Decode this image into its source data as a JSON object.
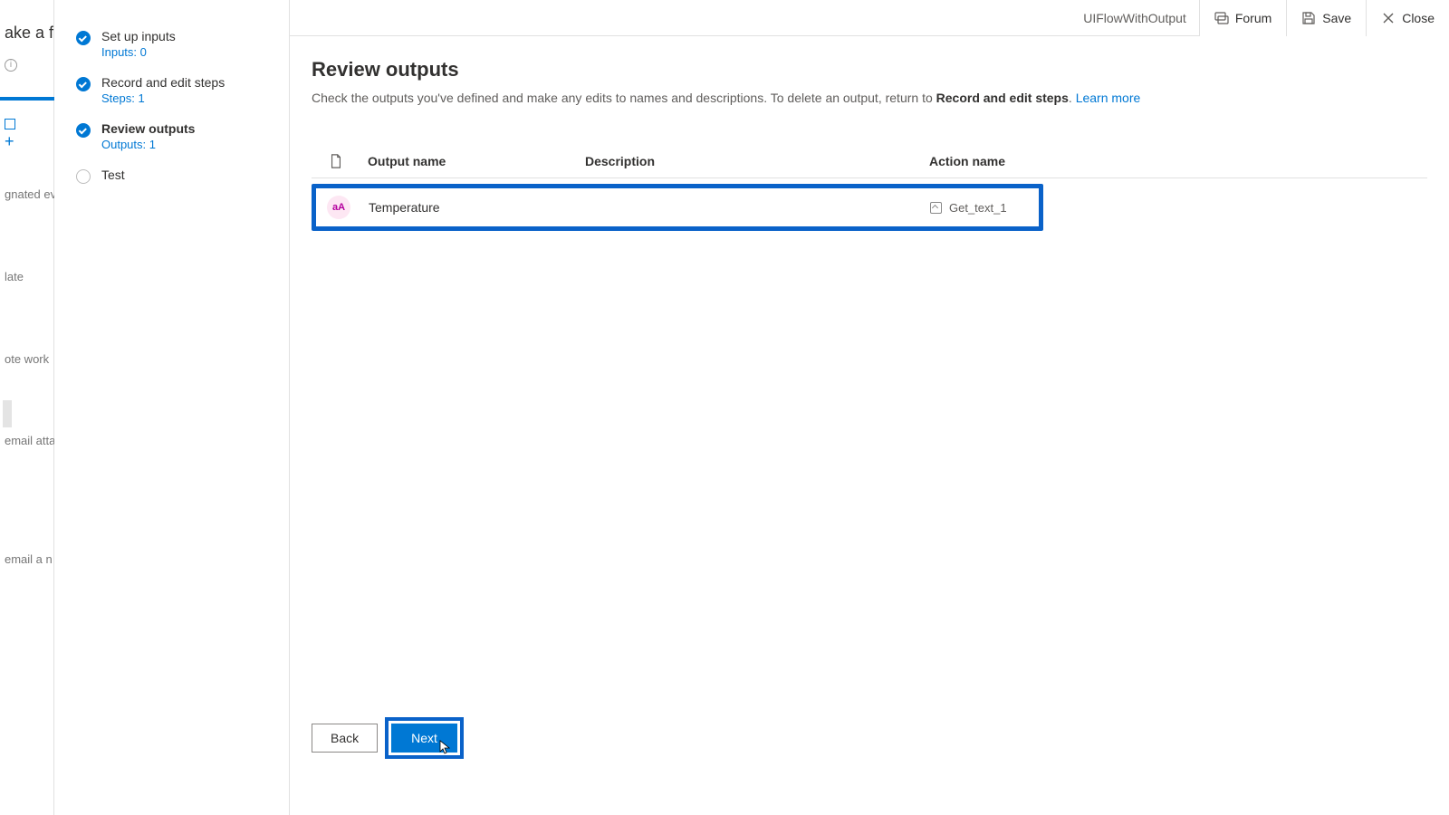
{
  "leftPartial": {
    "title": "ake a fl",
    "sidetexts": [
      "gnated even",
      "late",
      "ote work",
      "email attac",
      "email a n"
    ]
  },
  "wizard": {
    "steps": [
      {
        "title": "Set up inputs",
        "sub": "Inputs: 0",
        "state": "done"
      },
      {
        "title": "Record and edit steps",
        "sub": "Steps: 1",
        "state": "done"
      },
      {
        "title": "Review outputs",
        "sub": "Outputs: 1",
        "state": "current"
      },
      {
        "title": "Test",
        "sub": "",
        "state": "open"
      }
    ]
  },
  "topbar": {
    "flowName": "UIFlowWithOutput",
    "forum": "Forum",
    "save": "Save",
    "close": "Close"
  },
  "page": {
    "heading": "Review outputs",
    "subtitle_pre": "Check the outputs you've defined and make any edits to names and descriptions. To delete an output, return to ",
    "subtitle_strong": "Record and edit steps",
    "subtitle_post": ". ",
    "learnMore": "Learn more"
  },
  "table": {
    "columns": {
      "output": "Output name",
      "description": "Description",
      "action": "Action name"
    },
    "rows": [
      {
        "badge": "aA",
        "outputName": "Temperature",
        "description": "",
        "actionName": "Get_text_1"
      }
    ]
  },
  "footer": {
    "back": "Back",
    "next": "Next"
  }
}
